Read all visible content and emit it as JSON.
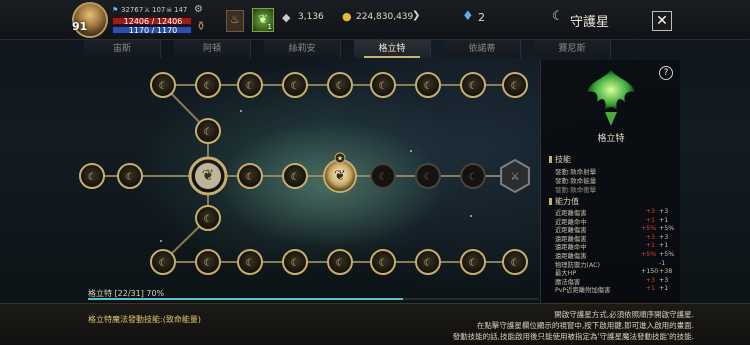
{
  "header": {
    "level": "91",
    "small_stats": [
      "32767",
      "107",
      "147"
    ],
    "hp": "12406 / 12406",
    "mp": "1170 / 1170",
    "buff_count": "1",
    "silver": "3,136",
    "gold": "224,830,439",
    "gems": "2",
    "title": "守護星",
    "close_icon": "close-icon"
  },
  "tabs": [
    {
      "label": "宙斯",
      "active": false
    },
    {
      "label": "阿頓",
      "active": false
    },
    {
      "label": "絲莉安",
      "active": false
    },
    {
      "label": "格立特",
      "active": true
    },
    {
      "label": "依諾蒂",
      "active": false
    },
    {
      "label": "賽尼斯",
      "active": false
    }
  ],
  "progress": {
    "label": "格立特 [22/31] 70%",
    "fraction": 0.7
  },
  "footer": {
    "left": "格立特魔法發動技能:(致命能量)",
    "right_lines": [
      "開啟守護星方式,必須依照順序開啟守護星.",
      "在點擊守護星欄位顯示的視窗中,按下啟用鍵,即可進入啟用的畫面.",
      "發動技能的話,技能啟用後只能使用被指定為'守護星魔法發動技能'的技能."
    ]
  },
  "panel": {
    "name": "格立特",
    "help": "?",
    "skills_title": "技能",
    "skills": [
      {
        "text": "發動:致命射擊",
        "on": true
      },
      {
        "text": "發動:致命能量",
        "on": true
      },
      {
        "text": "發動:致命衝擊",
        "on": false
      }
    ],
    "stats_title": "能力值",
    "stats": [
      {
        "name": "近距離傷害",
        "a": "+3",
        "b": "+3",
        "a_red": true
      },
      {
        "name": "近距離命中",
        "a": "+1",
        "b": "+1",
        "a_red": true
      },
      {
        "name": "近距離傷害",
        "a": "+5%",
        "b": "+5%",
        "a_red": true
      },
      {
        "name": "遠距離傷害",
        "a": "+3",
        "b": "+3",
        "a_red": true
      },
      {
        "name": "遠距離命中",
        "a": "+1",
        "b": "+1",
        "a_red": true
      },
      {
        "name": "遠距離傷害",
        "a": "+5%",
        "b": "+5%",
        "a_red": true
      },
      {
        "name": "物理防禦力(AC)",
        "a": "",
        "b": "-1",
        "a_red": true
      },
      {
        "name": "最大HP",
        "a": "+150",
        "b": "+38",
        "a_red": false
      },
      {
        "name": "魔法傷害",
        "a": "+3",
        "b": "+3",
        "a_red": true
      },
      {
        "name": "PvP近距離附加傷害",
        "a": "+1",
        "b": "+1",
        "a_red": true
      }
    ]
  },
  "colors": {
    "accent": "#c8b27a",
    "progress": "#57c0c8",
    "red_value": "#e23b3b",
    "bg": "#0b1016"
  }
}
